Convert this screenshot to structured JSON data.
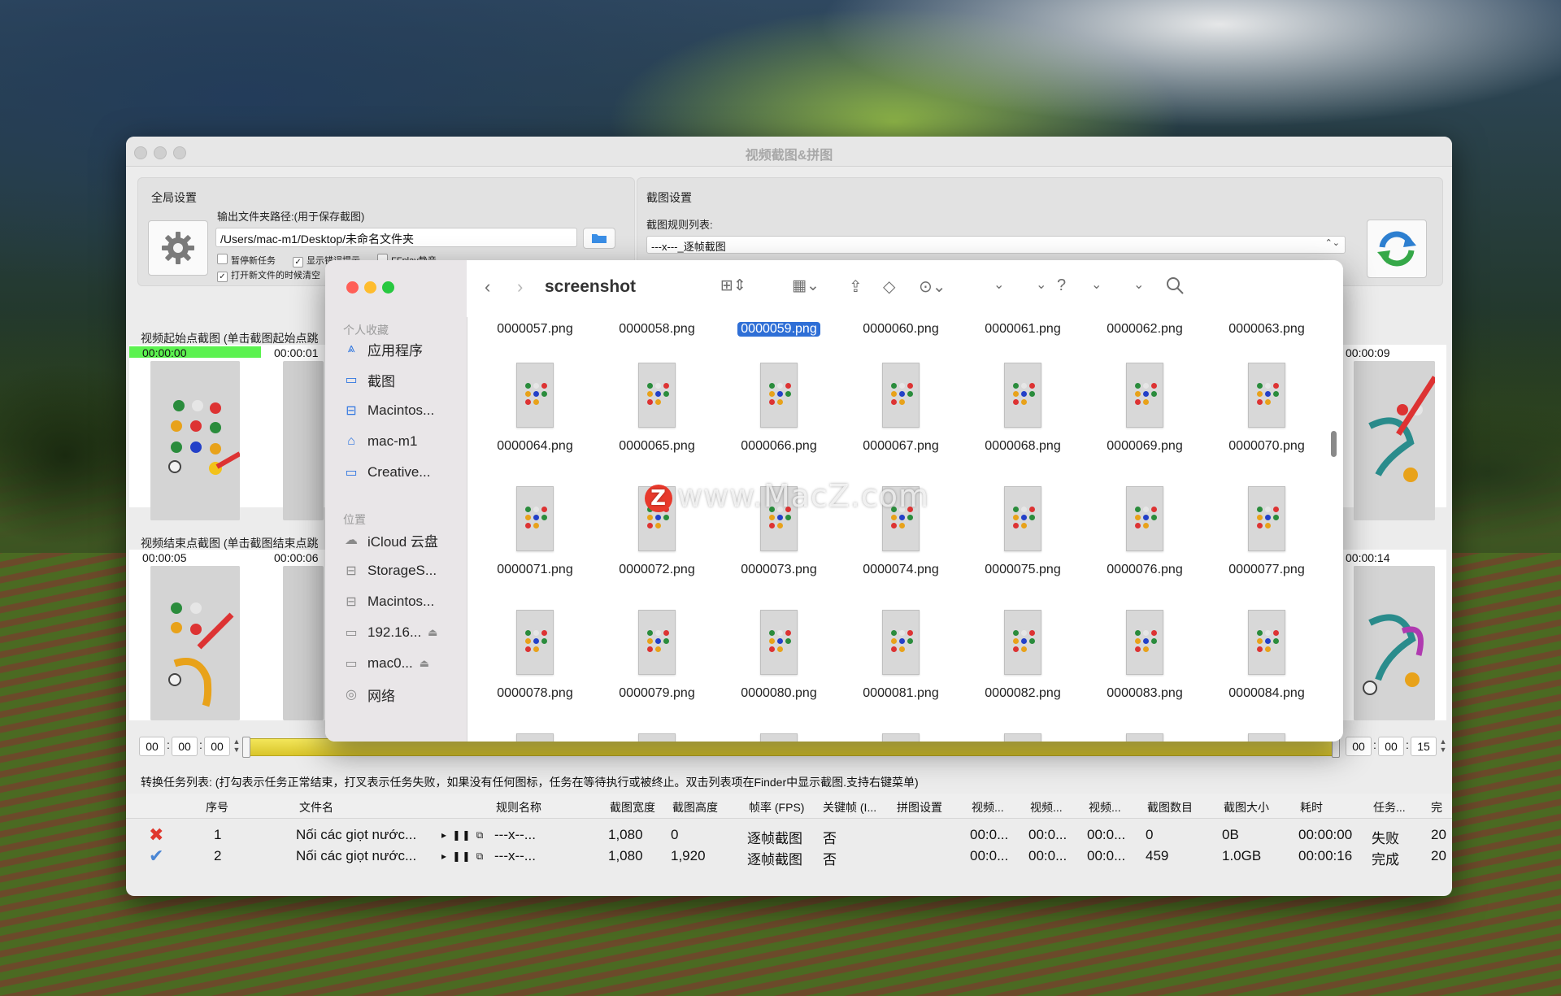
{
  "app": {
    "title": "视频截图&拼图",
    "global": {
      "label": "全局设置",
      "output_label": "输出文件夹路径:(用于保存截图)",
      "output_path": "/Users/mac-m1/Desktop/未命名文件夹",
      "opt_pause": "暂停新任务",
      "opt_show_errors": "显示错误提示",
      "opt_ffplay": "FFplay静音",
      "opt_clear": "打开新文件的时候清空"
    },
    "capture": {
      "label": "截图设置",
      "rules_label": "截图规则列表:",
      "rule_selected": "---x---_逐帧截图"
    },
    "start_label": "视频起始点截图 (单击截图起始点跳",
    "end_label": "视频结束点截图 (单击截图结束点跳",
    "start_times": [
      "00:00:00",
      "00:00:01",
      "00:00:09"
    ],
    "end_times": [
      "00:00:05",
      "00:00:06",
      "00:00:14"
    ],
    "left_time": [
      "00",
      "00",
      "00"
    ],
    "right_time": [
      "00",
      "00",
      "15"
    ],
    "task_list_label": "转换任务列表: (打勾表示任务正常结束，打叉表示任务失败，如果没有任何图标，任务在等待执行或被终止。双击列表项在Finder中显示截图.支持右键菜单)",
    "columns": [
      "序号",
      "文件名",
      "规则名称",
      "截图宽度",
      "截图高度",
      "帧率 (FPS)",
      "关键帧 (I...",
      "拼图设置",
      "视频...",
      "视频...",
      "视频...",
      "截图数目",
      "截图大小",
      "耗时",
      "任务...",
      "完"
    ],
    "rows": [
      {
        "status": "fail",
        "idx": "1",
        "file": "Nối các giọt nước...",
        "rule": "---x--...",
        "width": "1,080",
        "height": "0",
        "fps": "逐帧截图",
        "key": "否",
        "v1": "00:0...",
        "v2": "00:0...",
        "v3": "00:0...",
        "count": "0",
        "size": "0B",
        "time": "00:00:00",
        "state": "失败",
        "done": "20"
      },
      {
        "status": "ok",
        "idx": "2",
        "file": "Nối các giọt nước...",
        "rule": "---x--...",
        "width": "1,080",
        "height": "1,920",
        "fps": "逐帧截图",
        "key": "否",
        "v1": "00:0...",
        "v2": "00:0...",
        "v3": "00:0...",
        "count": "459",
        "size": "1.0GB",
        "time": "00:00:16",
        "state": "完成",
        "done": "20"
      }
    ],
    "colors": {
      "progress_green": "#5cf250",
      "slider_yellow": "#e6d22e",
      "refresh_blue": "#2d7fd0"
    }
  },
  "finder": {
    "title": "screenshot",
    "favorites_label": "个人收藏",
    "favorites": [
      "应用程序",
      "截图",
      "Macintos...",
      "mac-m1",
      "Creative..."
    ],
    "locations_label": "位置",
    "locations": [
      "iCloud 云盘",
      "StorageS...",
      "Macintos...",
      "192.16...",
      "mac0...",
      "网络"
    ],
    "top_row": [
      "0000057.png",
      "0000058.png",
      "0000059.png",
      "0000060.png",
      "0000061.png",
      "0000062.png",
      "0000063.png"
    ],
    "grid": [
      [
        "0000064.png",
        "0000065.png",
        "0000066.png",
        "0000067.png",
        "0000068.png",
        "0000069.png",
        "0000070.png"
      ],
      [
        "0000071.png",
        "0000072.png",
        "0000073.png",
        "0000074.png",
        "0000075.png",
        "0000076.png",
        "0000077.png"
      ],
      [
        "0000078.png",
        "0000079.png",
        "0000080.png",
        "0000081.png",
        "0000082.png",
        "0000083.png",
        "0000084.png"
      ]
    ]
  },
  "watermark": {
    "logo_letter": "Z",
    "text": "www.MacZ.com"
  }
}
